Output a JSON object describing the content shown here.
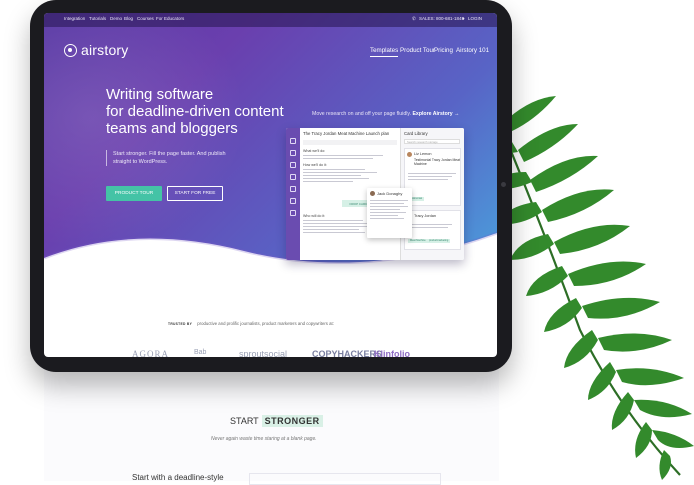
{
  "topbar": {
    "links": [
      "Integration",
      "Tutorials",
      "Demo",
      "Blog",
      "Courses",
      "For Educators"
    ],
    "sales": "SALES: 800-681-1845",
    "login": "LOGIN"
  },
  "brand": {
    "name": "airstory"
  },
  "nav": {
    "items": [
      "Templates",
      "Product Tour",
      "Pricing",
      "Airstory 101"
    ]
  },
  "hero": {
    "headline": [
      "Writing software",
      "for deadline-driven content",
      "teams and bloggers"
    ],
    "subtext": "Start stronger. Fill the page faster. And publish straight to WordPress.",
    "primary_button": "PRODUCT TOUR",
    "secondary_button": "START FOR FREE",
    "research_note": "Move research on and off your page fluidly.",
    "research_link": "Explore Airstory →"
  },
  "app_mock": {
    "doc_title": "The Tracy Jordan Meat Machine Launch plan",
    "sections": [
      "What we'll do:",
      "How we'll do it:",
      "Who will do it:"
    ],
    "green_button": "DROP CARD HERE",
    "library_title": "Card Library",
    "search_placeholder": "Search research storage",
    "cards": [
      {
        "name": "Liz Lemon",
        "subtitle": "Testimonial Tracy Jordan Meat Machine",
        "tag": "testimonial"
      },
      {
        "name": "Tracy Jordan",
        "subtitle": "Meat Machine",
        "tag": "productmarketing"
      }
    ],
    "comment_author": "Jack Donaghy"
  },
  "trusted": {
    "label": "TRUSTED BY",
    "text": "productive and prolific journalists, product marketers and copywriters at:",
    "logos": [
      "AGORA",
      "Bab",
      "sproutsocial",
      "COPYHACKERS",
      "Klinfolio"
    ]
  },
  "section": {
    "start": "START",
    "stronger": "STRONGER",
    "tagline": "Never again waste time staring at a blank page.",
    "next_heading": "Start with a deadline-style"
  },
  "colors": {
    "accent": "#44c3a6",
    "hero_purple": "#6a3fae",
    "hero_blue": "#4aa0dc",
    "fern": "#2f7a2a"
  }
}
